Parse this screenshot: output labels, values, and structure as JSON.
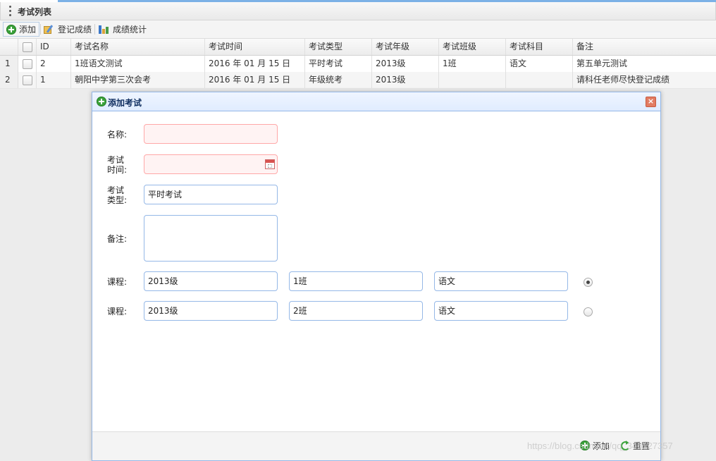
{
  "panel": {
    "title": "考试列表"
  },
  "toolbar": {
    "add_label": "添加",
    "record_label": "登记成绩",
    "stats_label": "成绩统计"
  },
  "grid": {
    "columns": [
      "ID",
      "考试名称",
      "考试时间",
      "考试类型",
      "考试年级",
      "考试班级",
      "考试科目",
      "备注"
    ],
    "rows": [
      {
        "num": "1",
        "id": "2",
        "name": "1班语文测试",
        "time": "2016 年 01 月 15 日",
        "type": "平时考试",
        "grade": "2013级",
        "class": "1班",
        "subject": "语文",
        "note": "第五单元测试"
      },
      {
        "num": "2",
        "id": "1",
        "name": "朝阳中学第三次会考",
        "time": "2016 年 01 月 15 日",
        "type": "年级统考",
        "grade": "2013级",
        "class": "",
        "subject": "",
        "note": "请科任老师尽快登记成绩"
      }
    ]
  },
  "dialog": {
    "title": "添加考试",
    "name_label": "名称:",
    "time_label_1": "考试",
    "time_label_2": "时间:",
    "type_label_1": "考试",
    "type_label_2": "类型:",
    "type_value": "平时考试",
    "remark_label": "备注:",
    "courses": [
      {
        "label": "课程:",
        "grade": "2013级",
        "class": "1班",
        "subject": "语文",
        "selected": true
      },
      {
        "label": "课程:",
        "grade": "2013级",
        "class": "2班",
        "subject": "语文",
        "selected": false
      }
    ],
    "add_label": "添加",
    "reset_label": "重置"
  },
  "watermark": "https://blog.csdn.net/qq_346127357"
}
